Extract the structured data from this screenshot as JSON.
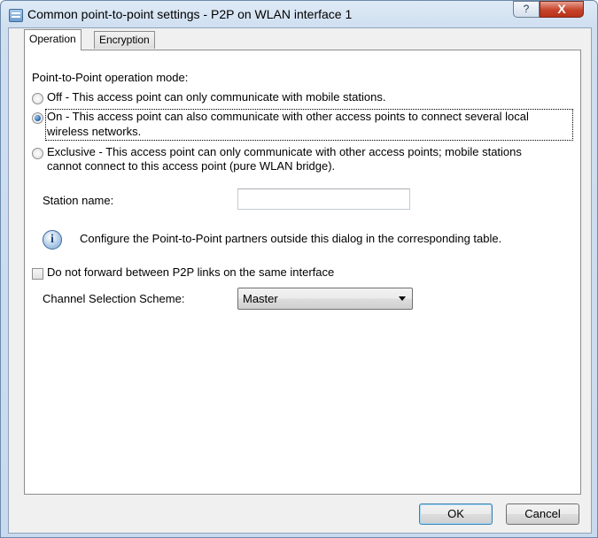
{
  "window": {
    "title": "Common point-to-point settings - P2P on WLAN interface 1",
    "help_label": "?",
    "close_label": "X"
  },
  "tabs": [
    {
      "label": "Operation",
      "selected": true
    },
    {
      "label": "Encryption",
      "selected": false
    }
  ],
  "operation": {
    "mode_heading": "Point-to-Point operation mode:",
    "modes": [
      {
        "line1": "Off - This access point can only communicate with mobile stations.",
        "line2": "",
        "checked": false
      },
      {
        "line1": "On - This access point can also communicate with other access points to connect several local",
        "line2": "wireless networks.",
        "checked": true
      },
      {
        "line1": "Exclusive - This access point can only communicate with other access points; mobile stations",
        "line2": "cannot connect to this access point (pure WLAN bridge).",
        "checked": false
      }
    ],
    "station_name_label": "Station name:",
    "station_name_value": "",
    "info_icon_glyph": "i",
    "info_text": "Configure the Point-to-Point partners outside this dialog in the corresponding table.",
    "no_forward_label": "Do not forward between P2P links on the same interface",
    "no_forward_checked": false,
    "channel_scheme_label": "Channel Selection Scheme:",
    "channel_scheme_value": "Master"
  },
  "footer": {
    "ok_label": "OK",
    "cancel_label": "Cancel"
  },
  "colors": {
    "title_gradient_top": "#dfeaf6",
    "close_button_red": "#c5432a",
    "radio_selected_blue": "#1f5fa6"
  }
}
